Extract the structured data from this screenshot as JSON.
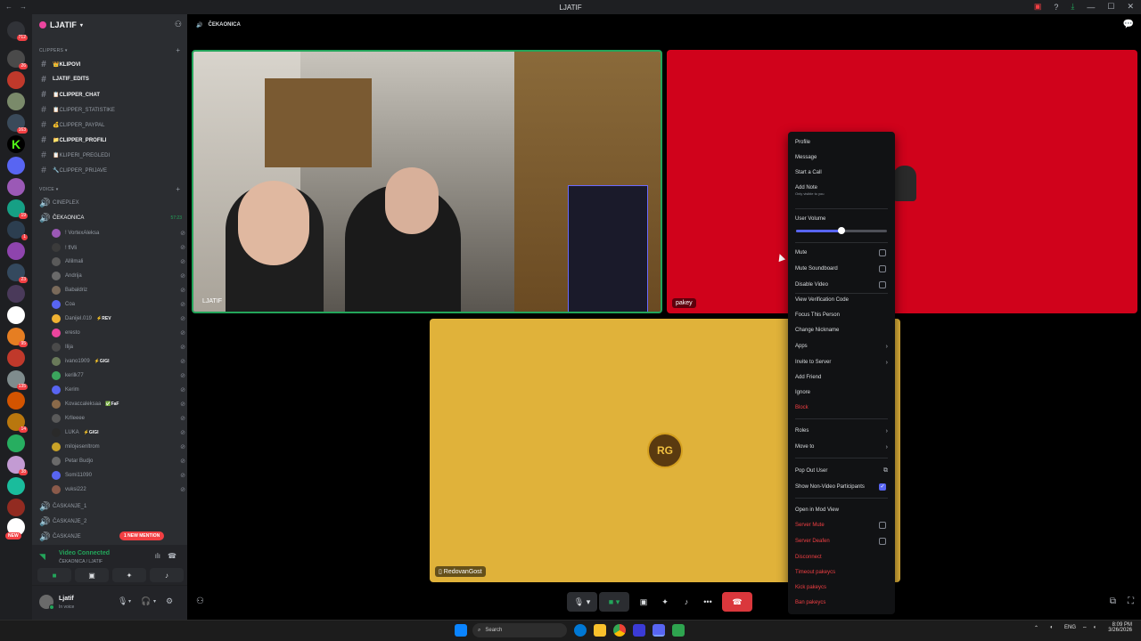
{
  "window": {
    "title": "LJATIF"
  },
  "servers": {
    "badges": [
      "712",
      "26",
      "163",
      "19",
      "1",
      "23",
      "95",
      "135",
      "14",
      "38"
    ],
    "new_label": "NEW"
  },
  "guild": {
    "name": "LJATIF"
  },
  "categories": {
    "clippers": "CLIPPERS",
    "voice": "VOICE"
  },
  "text_channels": [
    {
      "name": "👑KLIPOVI",
      "unread": true
    },
    {
      "name": "LJATIF_EDITS",
      "unread": true
    },
    {
      "name": "📋CLIPPER_CHAT",
      "unread": true
    },
    {
      "name": "📋CLIPPER_STATISTIKE",
      "unread": false
    },
    {
      "name": "💰CLIPPER_PAYPAL",
      "unread": false
    },
    {
      "name": "📁CLIPPER_PROFILI",
      "unread": true
    },
    {
      "name": "📋KLIPERI_PREGLEDI",
      "unread": false
    },
    {
      "name": "🔧CLIPPER_PRIJAVE",
      "unread": false
    }
  ],
  "voice_channels": {
    "cineplex": "CINEPLEX",
    "cekaonica": "ČEKAONICA",
    "cekaonica_time": "57:23",
    "caskanje1": "ČASKANJE_1",
    "caskanje2": "ČASKANJE_2",
    "caskanje3": "ČASKANJE"
  },
  "voice_users": [
    {
      "name": "! VortexAleksa",
      "tag": "",
      "color": "#9b59b6"
    },
    {
      "name": "! flⅥi",
      "tag": "",
      "color": "#3b3b3b"
    },
    {
      "name": "Allilmali",
      "tag": "",
      "color": "#5a5a5a"
    },
    {
      "name": "Andrija",
      "tag": "",
      "color": "#6a6a6a"
    },
    {
      "name": "Babaldriz",
      "tag": "",
      "color": "#7a6a5a"
    },
    {
      "name": "Coa",
      "tag": "",
      "color": "#5865f2"
    },
    {
      "name": "Danijel.019",
      "tag": "⚡REV",
      "color": "#f0b232"
    },
    {
      "name": "eresto",
      "tag": "",
      "color": "#eb459e"
    },
    {
      "name": "Ilija",
      "tag": "",
      "color": "#4a4a4a"
    },
    {
      "name": "ivano1909",
      "tag": "⚡GIGI",
      "color": "#6a7a5a"
    },
    {
      "name": "kerilk77",
      "tag": "",
      "color": "#3ba55d"
    },
    {
      "name": "Kerim",
      "tag": "",
      "color": "#5865f2"
    },
    {
      "name": "Kovaccaleksaa",
      "tag": "✅FaF",
      "color": "#8a6a4a"
    },
    {
      "name": "Krlleeee",
      "tag": "",
      "color": "#5a5a5a"
    },
    {
      "name": "LUKA",
      "tag": "⚡GIGI",
      "color": "#2a2a2a"
    },
    {
      "name": "milojesenltrom",
      "tag": "",
      "color": "#c9a227"
    },
    {
      "name": "Petar Budjo",
      "tag": "",
      "color": "#6a6a6a"
    },
    {
      "name": "Somi11090",
      "tag": "",
      "color": "#5865f2"
    },
    {
      "name": "vuksi222",
      "tag": "",
      "color": "#8a5a4a"
    }
  ],
  "mention_badge": "1 NEW MENTION",
  "voice_panel": {
    "status": "Video Connected",
    "channel": "ČEKAONICA / LJATIF"
  },
  "user_panel": {
    "name": "Ljatif",
    "status": "In voice"
  },
  "stage": {
    "channel": "ČEKAONICA"
  },
  "tiles": {
    "ljatif": "LJATIF",
    "pakey": "pakey",
    "redovan": "RedovanGost",
    "redovan_logo": "RG"
  },
  "context_menu": {
    "profile": "Profile",
    "message": "Message",
    "start_call": "Start a Call",
    "add_note": "Add Note",
    "add_note_sub": "Only visible to you",
    "user_volume": "User Volume",
    "volume_fraction": 0.5,
    "mute": "Mute",
    "mute_soundboard": "Mute Soundboard",
    "disable_video": "Disable Video",
    "view_verification": "View Verification Code",
    "focus": "Focus This Person",
    "change_nickname": "Change Nickname",
    "apps": "Apps",
    "invite": "Invite to Server",
    "add_friend": "Add Friend",
    "ignore": "Ignore",
    "block": "Block",
    "roles": "Roles",
    "move_to": "Move to",
    "pop_out": "Pop Out User",
    "show_non_video": "Show Non-Video Participants",
    "mod_view": "Open in Mod View",
    "server_mute": "Server Mute",
    "server_deafen": "Server Deafen",
    "disconnect": "Disconnect",
    "timeout": "Timeout pakeycs",
    "kick": "Kick pakeycs",
    "ban": "Ban pakeycs"
  },
  "taskbar": {
    "search": "Search",
    "lang": "ENG",
    "time": "8:09 PM",
    "date": "3/26/2026"
  },
  "colors": {
    "accent": "#5865f2",
    "danger": "#f23f43",
    "online": "#23a55a",
    "pakey_bg": "#d0021b",
    "redovan_bg": "#e0b23a"
  }
}
